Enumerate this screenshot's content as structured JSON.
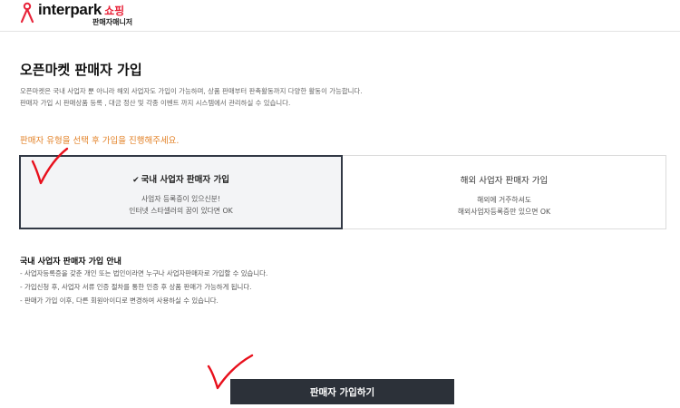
{
  "header": {
    "brand": "interpark",
    "brand_suffix": "쇼핑",
    "subtitle": "판매자매니저",
    "brand_color": "#e8243a"
  },
  "main": {
    "title": "오픈마켓 판매자 가입",
    "intro_lines": [
      "오픈마켓은 국내 사업자 뿐 아니라 해외 사업자도 가입이 가능하며, 상품 판매부터 판촉활동까지 다양한 활동이 가능합니다.",
      "판매자 가입 시 판매상품 등록 , 대금 정산 및 각종 이벤트 까지 시스템에서 관리하실 수 있습니다."
    ],
    "prompt": "판매자 유형을 선택 후 가입을 진행해주세요.",
    "prompt_color": "#e3832a"
  },
  "seller_types": [
    {
      "title": "국내 사업자 판매자 가입",
      "selected": true,
      "desc_lines": [
        "사업자 등록증이 있으신분!",
        "인터넷 스타셀러의 꿈이 있다면 OK"
      ]
    },
    {
      "title": "해외 사업자 판매자 가입",
      "selected": false,
      "desc_lines": [
        "해외에 거주하셔도",
        "해외사업자등록증만 있으면 OK"
      ]
    }
  ],
  "guide": {
    "title": "국내 사업자 판매자 가입 안내",
    "items": [
      "- 사업자등록증을 갖춘 개인 또는 법인이라면 누구나 사업자판매자로 가입할 수 있습니다.",
      "- 가입신청 후, 사업자 서류 인증 절차를 통한 인증 후 상품 판매가 가능하게 됩니다.",
      "- 판매가 가입 이후, 다른 회원아이디로 변경하여 사용하실 수 있습니다."
    ]
  },
  "submit": {
    "label": "판매자 가입하기",
    "bg_color": "#2c3139"
  },
  "check_icon": "checkmark-icon",
  "annotation_color": "#e8101c"
}
